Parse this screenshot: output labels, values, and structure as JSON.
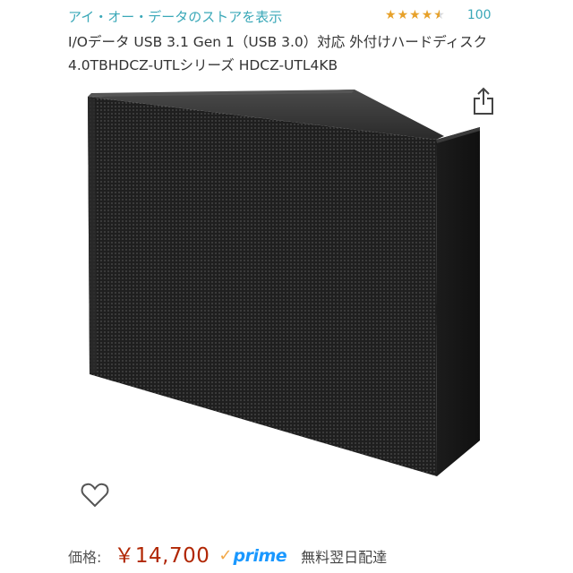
{
  "store": {
    "link_text": "アイ・オー・データのストアを表示"
  },
  "rating": {
    "stars": 4.5,
    "count": "100",
    "star_color": "#e7a12a"
  },
  "product": {
    "title": "I/Oデータ USB 3.1 Gen 1（USB 3.0）対応 外付けハードディスク 4.0TBHDCZ-UTLシリーズ HDCZ-UTL4KB"
  },
  "icons": {
    "share": "share-icon",
    "wishlist": "heart-icon",
    "prime_check": "check-icon"
  },
  "price": {
    "label": "価格:",
    "value": "￥14,700",
    "prime_check": "✓",
    "prime_text": "prime",
    "shipping": "無料翌日配達",
    "price_color": "#b12704",
    "prime_color": "#1a98ff"
  },
  "colors": {
    "link": "#3aa8b8"
  }
}
